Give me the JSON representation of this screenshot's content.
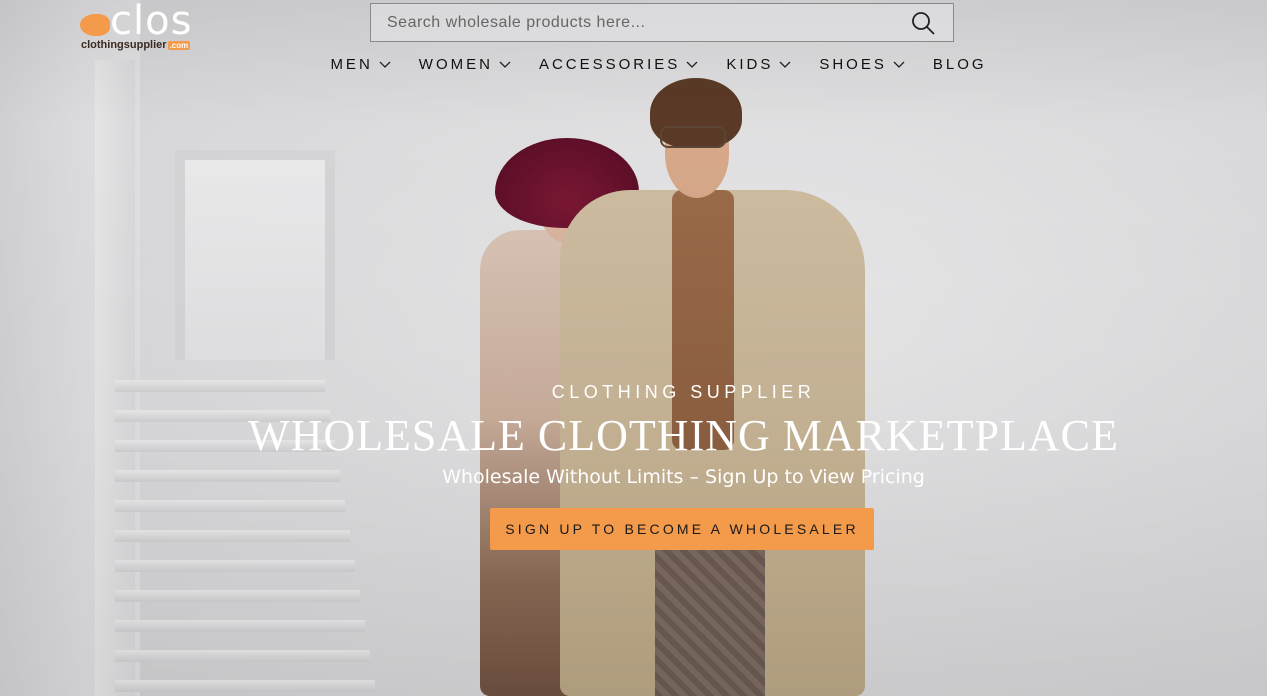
{
  "header": {
    "logo": {
      "wordmark": "clos",
      "subtext": "clothingsupplier",
      "subtext_suffix": ".com"
    },
    "search": {
      "placeholder": "Search wholesale products here...",
      "icon": "search-icon"
    },
    "nav": [
      {
        "label": "MEN",
        "has_dropdown": true
      },
      {
        "label": "WOMEN",
        "has_dropdown": true
      },
      {
        "label": "ACCESSORIES",
        "has_dropdown": true
      },
      {
        "label": "KIDS",
        "has_dropdown": true
      },
      {
        "label": "SHOES",
        "has_dropdown": true
      },
      {
        "label": "BLOG",
        "has_dropdown": false
      }
    ]
  },
  "hero": {
    "kicker": "CLOTHING SUPPLIER",
    "title": "WHOLESALE CLOTHING MARKETPLACE",
    "subtitle": "Wholesale Without Limits – Sign Up to View Pricing",
    "cta_label": "SIGN UP TO BECOME A WHOLESALER"
  },
  "colors": {
    "accent": "#f39a4b",
    "hero_text": "#ffffff",
    "nav_text": "#111111"
  }
}
